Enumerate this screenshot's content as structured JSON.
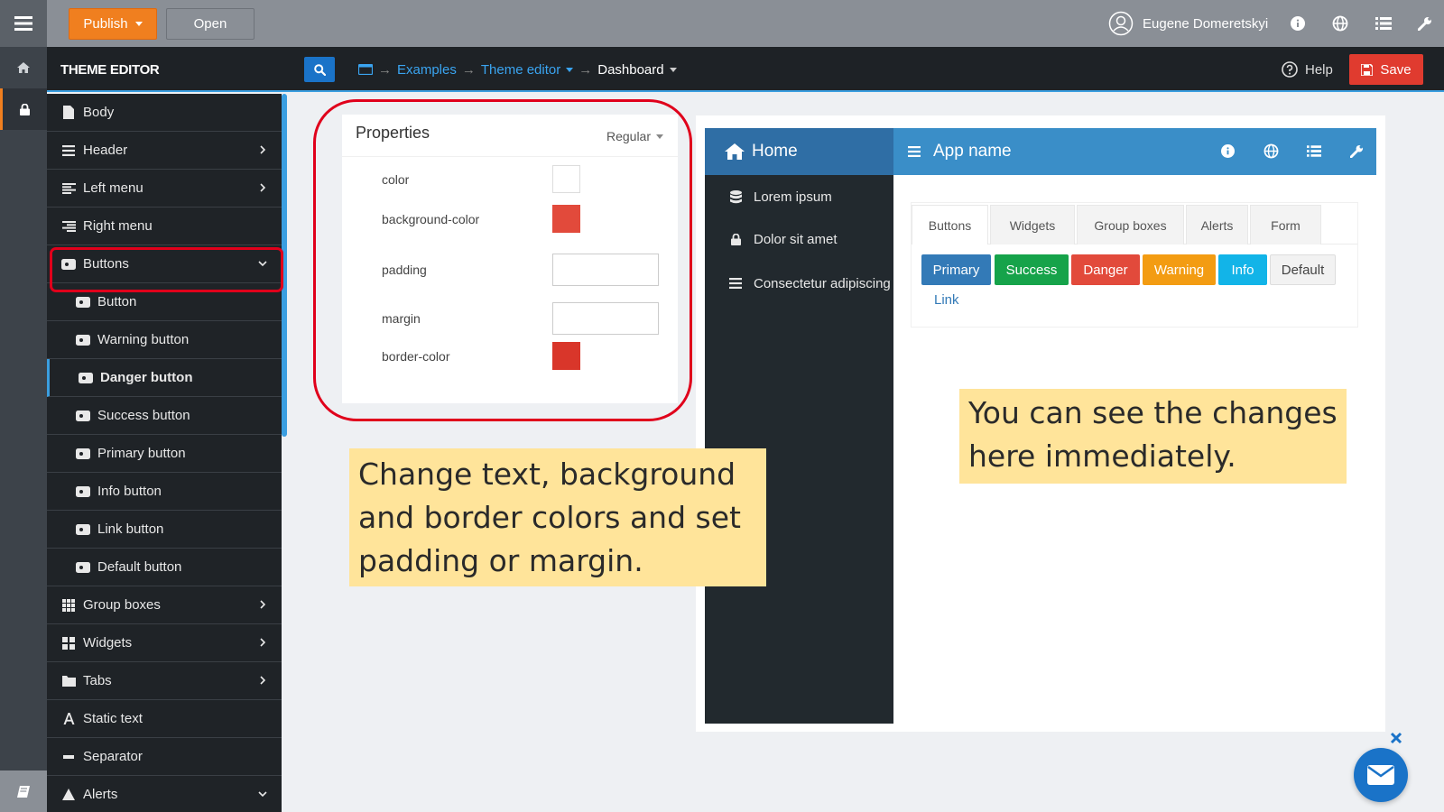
{
  "topbar": {
    "publish_label": "Publish",
    "open_label": "Open",
    "user_name": "Eugene Domeretskyi"
  },
  "subbar": {
    "title": "THEME EDITOR",
    "breadcrumb": [
      "Examples",
      "Theme editor",
      "Dashboard"
    ],
    "help_label": "Help",
    "save_label": "Save"
  },
  "tree": {
    "items": [
      {
        "label": "Body",
        "icon": "file-icon",
        "child": false,
        "chevron": ""
      },
      {
        "label": "Header",
        "icon": "menu-icon",
        "child": false,
        "chevron": "right"
      },
      {
        "label": "Left menu",
        "icon": "left-align-icon",
        "child": false,
        "chevron": "right"
      },
      {
        "label": "Right menu",
        "icon": "right-align-icon",
        "child": false,
        "chevron": ""
      },
      {
        "label": "Buttons",
        "icon": "button-icon",
        "child": false,
        "chevron": "down"
      },
      {
        "label": "Button",
        "icon": "button-icon",
        "child": true,
        "chevron": ""
      },
      {
        "label": "Warning button",
        "icon": "button-icon",
        "child": true,
        "chevron": ""
      },
      {
        "label": "Danger button",
        "icon": "button-icon",
        "child": true,
        "chevron": "",
        "active": true
      },
      {
        "label": "Success button",
        "icon": "button-icon",
        "child": true,
        "chevron": ""
      },
      {
        "label": "Primary button",
        "icon": "button-icon",
        "child": true,
        "chevron": ""
      },
      {
        "label": "Info button",
        "icon": "button-icon",
        "child": true,
        "chevron": ""
      },
      {
        "label": "Link button",
        "icon": "button-icon",
        "child": true,
        "chevron": ""
      },
      {
        "label": "Default button",
        "icon": "button-icon",
        "child": true,
        "chevron": ""
      },
      {
        "label": "Group boxes",
        "icon": "grid-icon",
        "child": false,
        "chevron": "right"
      },
      {
        "label": "Widgets",
        "icon": "widgets-icon",
        "child": false,
        "chevron": "right"
      },
      {
        "label": "Tabs",
        "icon": "folder-icon",
        "child": false,
        "chevron": "right"
      },
      {
        "label": "Static text",
        "icon": "text-icon",
        "child": false,
        "chevron": ""
      },
      {
        "label": "Separator",
        "icon": "separator-icon",
        "child": false,
        "chevron": ""
      },
      {
        "label": "Alerts",
        "icon": "alert-icon",
        "child": false,
        "chevron": "down"
      }
    ]
  },
  "properties": {
    "title": "Properties",
    "mode": "Regular",
    "fields": [
      {
        "label": "color",
        "kind": "swatch",
        "value": "#ffffff"
      },
      {
        "label": "background-color",
        "kind": "swatch",
        "value": "#e24a3b"
      },
      {
        "label": "padding",
        "kind": "input",
        "value": ""
      },
      {
        "label": "margin",
        "kind": "input",
        "value": ""
      },
      {
        "label": "border-color",
        "kind": "swatch",
        "value": "#d9362a"
      }
    ]
  },
  "callouts": {
    "left": "Change text, background and border colors and set padding or margin.",
    "right": "You can see the changes here immediately."
  },
  "preview": {
    "home_label": "Home",
    "app_name": "App name",
    "side_items": [
      {
        "label": "Lorem ipsum",
        "icon": "database-icon"
      },
      {
        "label": "Dolor sit amet",
        "icon": "lock-icon"
      },
      {
        "label": "Consectetur adipiscing",
        "icon": "menu-icon"
      }
    ],
    "tabs": [
      "Buttons",
      "Widgets",
      "Group boxes",
      "Alerts",
      "Form"
    ],
    "buttons": [
      {
        "label": "Primary",
        "color": "#337ab7"
      },
      {
        "label": "Success",
        "color": "#16a34a"
      },
      {
        "label": "Danger",
        "color": "#e24a3b"
      },
      {
        "label": "Warning",
        "color": "#f39c12"
      },
      {
        "label": "Info",
        "color": "#12b4e8"
      },
      {
        "label": "Default",
        "color": "#f2f2f2"
      }
    ],
    "link_label": "Link"
  },
  "colors": {
    "accent": "#f07f1f",
    "primary_blue": "#3a9ee0",
    "save_red": "#e03b2f",
    "highlight_red": "#e0001b",
    "callout_yellow": "#ffe49a"
  }
}
